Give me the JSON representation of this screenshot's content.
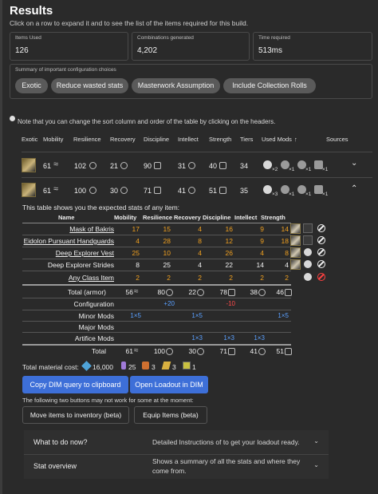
{
  "header": {
    "title": "Results",
    "subtitle": "Click on a row to expand it and to see the list of the items required for this build."
  },
  "stats": {
    "items_used_label": "Items Used",
    "items_used": "126",
    "combinations_label": "Combinations generated",
    "combinations": "4,202",
    "time_label": "Time required",
    "time": "513ms"
  },
  "summary": {
    "label": "Summary of important configuration choices",
    "chips": [
      "Exotic",
      "Reduce wasted stats",
      "Masterwork Assumption",
      "Include Collection Rolls"
    ]
  },
  "note": "Note that you can change the sort column and order of the table by clicking on the headers.",
  "columns": [
    "Exotic",
    "Mobility",
    "Resilience",
    "Recovery",
    "Discipline",
    "Intellect",
    "Strength",
    "Tiers",
    "Used Mods",
    "Sources"
  ],
  "sort_indicator": "↑",
  "results": [
    {
      "mobility": "61",
      "resilience": "102",
      "recovery": "21",
      "discipline": "90",
      "intellect": "31",
      "strength": "40",
      "tiers": "34",
      "mods": [
        "×2",
        "×1",
        "×1",
        "×1"
      ],
      "expanded": false
    },
    {
      "mobility": "61",
      "resilience": "100",
      "recovery": "30",
      "discipline": "71",
      "intellect": "41",
      "strength": "51",
      "tiers": "35",
      "mods": [
        "×3",
        "×1",
        "×1",
        "×1"
      ],
      "expanded": true
    }
  ],
  "detail": {
    "intro": "This table shows you the expected stats of any item:",
    "headers": [
      "Name",
      "Mobility",
      "Resilience",
      "Recovery",
      "Discipline",
      "Intellect",
      "Strength"
    ],
    "items": [
      {
        "name": "Mask of Bakris",
        "linked": true,
        "values": [
          "17",
          "15",
          "4",
          "16",
          "9",
          "14"
        ],
        "exotic": true
      },
      {
        "name": "Eidolon Pursuant Handguards",
        "linked": true,
        "values": [
          "4",
          "28",
          "8",
          "12",
          "9",
          "18"
        ],
        "exotic": false
      },
      {
        "name": "Deep Explorer Vest",
        "linked": true,
        "values": [
          "25",
          "10",
          "4",
          "26",
          "4",
          "8"
        ],
        "exotic": false
      },
      {
        "name": "Deep Explorer Strides",
        "linked": false,
        "values": [
          "8",
          "25",
          "4",
          "22",
          "14",
          "4"
        ],
        "exotic": false
      },
      {
        "name": "Any Class Item",
        "linked": true,
        "values": [
          "2",
          "2",
          "2",
          "2",
          "2",
          "2"
        ],
        "exotic": false
      }
    ],
    "total_armor_label": "Total (armor)",
    "total_armor": [
      "56",
      "80",
      "22",
      "78",
      "38",
      "46"
    ],
    "configuration_label": "Configuration",
    "configuration": [
      "",
      "+20",
      "",
      "-10",
      "",
      ""
    ],
    "minor_mods_label": "Minor Mods",
    "minor_mods": [
      "1×5",
      "",
      "1×5",
      "",
      "",
      "1×5"
    ],
    "major_mods_label": "Major Mods",
    "artifice_mods_label": "Artifice Mods",
    "artifice_mods": [
      "",
      "",
      "1×3",
      "1×3",
      "1×3",
      ""
    ],
    "total_label": "Total",
    "total": [
      "61",
      "100",
      "30",
      "71",
      "41",
      "51"
    ]
  },
  "material_cost": {
    "label": "Total material cost:",
    "glimmer": "16,000",
    "legendary_shards": "25",
    "enhancement_cores": "3",
    "prisms": "3",
    "ascendant": "1"
  },
  "actions": {
    "copy_dim": "Copy DIM query to clipboard",
    "open_dim": "Open Loadout in DIM",
    "warning": "The following two buttons may not work for some at the moment:",
    "move_items": "Move items to inventory (beta)",
    "equip_items": "Equip Items (beta)"
  },
  "accordion": [
    {
      "title": "What to do now?",
      "desc": "Detailed Instructions of to get your loadout ready."
    },
    {
      "title": "Stat overview",
      "desc1": "Shows a summary of all the stats and where they",
      "desc2": "come from."
    }
  ],
  "colors": {
    "accent": "#3d6fd8",
    "orange": "#f0a020",
    "blue": "#5aa0ff",
    "red": "#ff4a4a"
  }
}
